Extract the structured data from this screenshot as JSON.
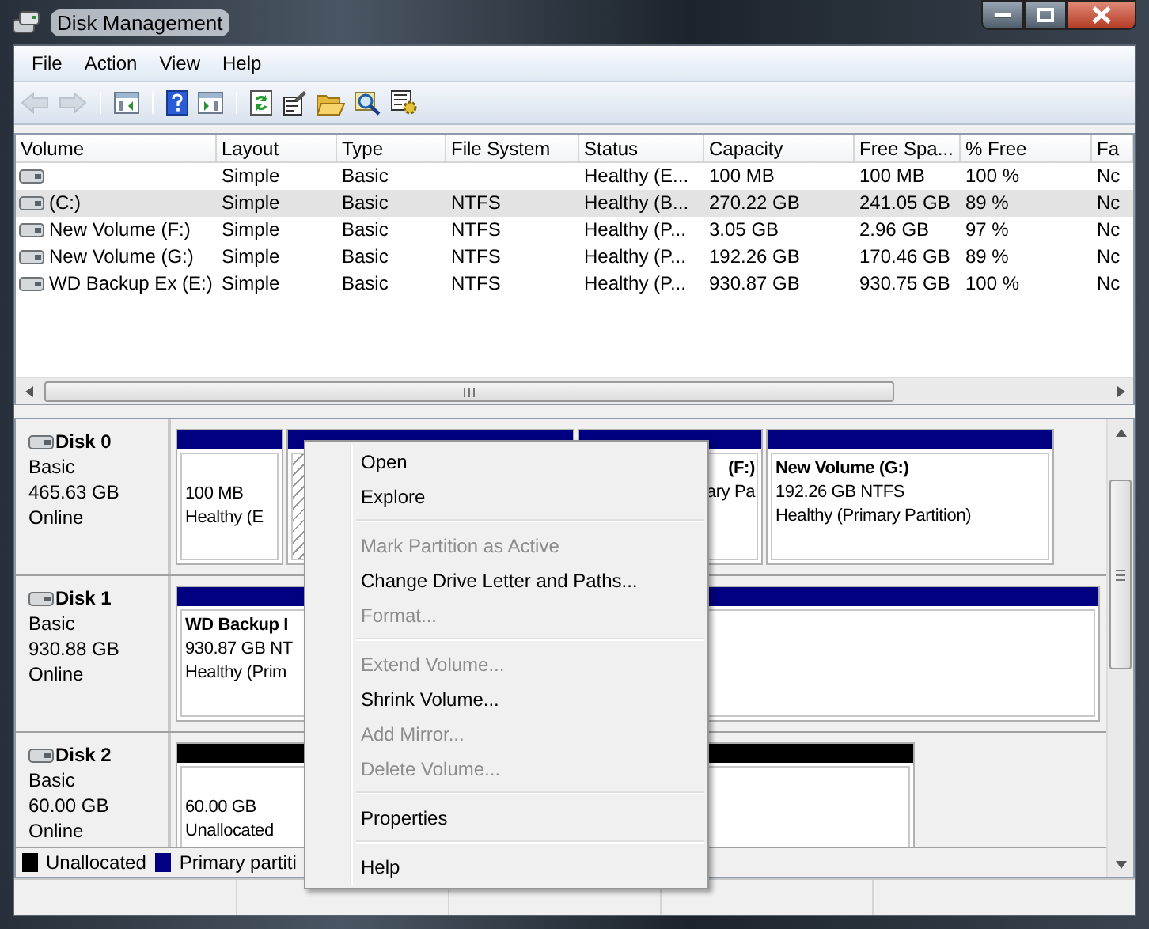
{
  "window": {
    "title": "Disk Management"
  },
  "menu_bar": [
    "File",
    "Action",
    "View",
    "Help"
  ],
  "toolbar": [
    {
      "kind": "back",
      "disabled": true
    },
    {
      "kind": "forward",
      "disabled": true
    },
    {
      "kind": "separator"
    },
    {
      "kind": "tree",
      "disabled": false
    },
    {
      "kind": "separator"
    },
    {
      "kind": "help",
      "disabled": false
    },
    {
      "kind": "pane",
      "disabled": false
    },
    {
      "kind": "separator"
    },
    {
      "kind": "refresh",
      "disabled": false
    },
    {
      "kind": "properties",
      "disabled": false
    },
    {
      "kind": "folder",
      "disabled": false
    },
    {
      "kind": "search",
      "disabled": false
    },
    {
      "kind": "settings",
      "disabled": false
    }
  ],
  "table": {
    "columns": [
      "Volume",
      "Layout",
      "Type",
      "File System",
      "Status",
      "Capacity",
      "Free Spa...",
      "% Free",
      "Fa"
    ],
    "rows": [
      {
        "selected": false,
        "layout": "Simple",
        "type": "Basic",
        "status": "Healthy (E...",
        "capacity": "100 MB",
        "free_space": "100 MB",
        "percent_free": "100 %",
        "column_9": "Nc"
      },
      {
        "selected": true,
        "volume": "(C:)",
        "layout": "Simple",
        "type": "Basic",
        "file_system": "NTFS",
        "status": "Healthy (B...",
        "capacity": "270.22 GB",
        "free_space": "241.05 GB",
        "percent_free": "89 %",
        "column_9": "Nc"
      },
      {
        "selected": false,
        "volume": "New Volume (F:)",
        "layout": "Simple",
        "type": "Basic",
        "file_system": "NTFS",
        "status": "Healthy (P...",
        "capacity": "3.05 GB",
        "free_space": "2.96 GB",
        "percent_free": "97 %",
        "column_9": "Nc"
      },
      {
        "selected": false,
        "volume": "New Volume (G:)",
        "layout": "Simple",
        "type": "Basic",
        "file_system": "NTFS",
        "status": "Healthy (P...",
        "capacity": "192.26 GB",
        "free_space": "170.46 GB",
        "percent_free": "89 %",
        "column_9": "Nc"
      },
      {
        "selected": false,
        "volume": "WD Backup Ex  (E:)",
        "layout": "Simple",
        "type": "Basic",
        "file_system": "NTFS",
        "status": "Healthy (P...",
        "capacity": "930.87 GB",
        "free_space": "930.75 GB",
        "percent_free": "100 %",
        "column_9": "Nc"
      }
    ]
  },
  "disks": [
    {
      "name": "Disk 0",
      "type": "Basic",
      "size": "465.63 GB",
      "state": "Online",
      "partitions": [
        {
          "kind": "primary",
          "selected": false,
          "covered": false,
          "lines": [
            "100 MB",
            "Healthy (E"
          ]
        },
        {
          "kind": "primary",
          "selected": true,
          "covered": true
        },
        {
          "kind": "primary",
          "selected": false,
          "covered": true,
          "title": "(F:)",
          "lines": [
            "ary Pa"
          ]
        },
        {
          "kind": "primary",
          "selected": false,
          "covered": false,
          "title": "New Volume  (G:)",
          "lines": [
            "192.26 GB NTFS",
            "Healthy (Primary Partition)"
          ]
        }
      ]
    },
    {
      "name": "Disk 1",
      "type": "Basic",
      "size": "930.88 GB",
      "state": "Online",
      "partitions": [
        {
          "kind": "primary",
          "selected": false,
          "covered": false,
          "title": "WD Backup I",
          "lines": [
            "930.87 GB NT",
            "Healthy (Prim"
          ]
        }
      ]
    },
    {
      "name": "Disk 2",
      "type": "Basic",
      "size": "60.00 GB",
      "state": "Online",
      "partitions": [
        {
          "kind": "unallocated",
          "selected": false,
          "covered": false,
          "lines": [
            "60.00 GB",
            "Unallocated"
          ]
        }
      ]
    }
  ],
  "legend": [
    {
      "label": "Unallocated",
      "color": "#000000"
    },
    {
      "label": "Primary partiti",
      "color": "#000080"
    }
  ],
  "context_menu": {
    "items": [
      {
        "kind": "item",
        "label": "Open",
        "disabled": false
      },
      {
        "kind": "item",
        "label": "Explore",
        "disabled": false
      },
      {
        "kind": "separator"
      },
      {
        "kind": "item",
        "label": "Mark Partition as Active",
        "disabled": true
      },
      {
        "kind": "item",
        "label": "Change Drive Letter and Paths...",
        "disabled": false
      },
      {
        "kind": "item",
        "label": "Format...",
        "disabled": true
      },
      {
        "kind": "separator"
      },
      {
        "kind": "item",
        "label": "Extend Volume...",
        "disabled": true
      },
      {
        "kind": "item",
        "label": "Shrink Volume...",
        "disabled": false
      },
      {
        "kind": "item",
        "label": "Add Mirror...",
        "disabled": true
      },
      {
        "kind": "item",
        "label": "Delete Volume...",
        "disabled": true
      },
      {
        "kind": "separator"
      },
      {
        "kind": "item",
        "label": "Properties",
        "disabled": false
      },
      {
        "kind": "separator"
      },
      {
        "kind": "item",
        "label": "Help",
        "disabled": false
      }
    ]
  }
}
